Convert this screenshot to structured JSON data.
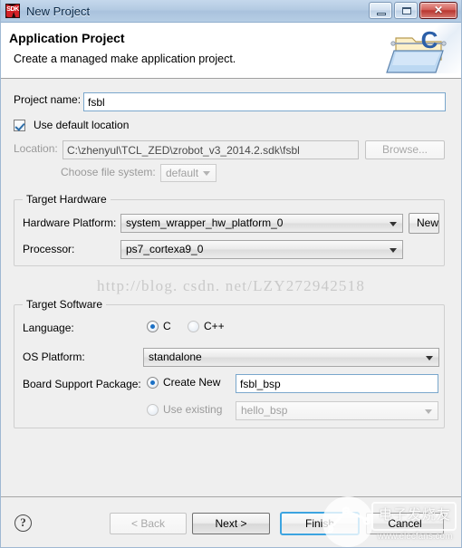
{
  "window": {
    "title": "New Project",
    "app_icon": "sdk-icon",
    "app_icon_text": "SDK",
    "controls": {
      "minimize": "minimize-button",
      "maximize": "maximize-button",
      "close": "close-button",
      "close_glyph": "✕"
    }
  },
  "header": {
    "title": "Application Project",
    "subtitle": "Create a managed make application project.",
    "icon": "c-project-folder-icon"
  },
  "form": {
    "project_name_label": "Project name:",
    "project_name_value": "fsbl",
    "project_name_placeholder": "",
    "use_default_location_label": "Use default location",
    "use_default_location_checked": true,
    "location_label": "Location:",
    "location_value": "C:\\zhenyul\\TCL_ZED\\zrobot_v3_2014.2.sdk\\fsbl",
    "browse_label": "Browse...",
    "choose_fs_label": "Choose file system:",
    "choose_fs_value": "default"
  },
  "target_hardware": {
    "group_title": "Target Hardware",
    "hardware_platform_label": "Hardware Platform:",
    "hardware_platform_value": "system_wrapper_hw_platform_0",
    "new_button_label": "New",
    "processor_label": "Processor:",
    "processor_value": "ps7_cortexa9_0"
  },
  "target_software": {
    "group_title": "Target Software",
    "language_label": "Language:",
    "language_options": [
      {
        "label": "C",
        "selected": true
      },
      {
        "label": "C++",
        "selected": false
      }
    ],
    "os_platform_label": "OS Platform:",
    "os_platform_value": "standalone",
    "bsp_label": "Board Support Package:",
    "bsp_create_new_label": "Create New",
    "bsp_create_new_selected": true,
    "bsp_create_new_value": "fsbl_bsp",
    "bsp_use_existing_label": "Use existing",
    "bsp_use_existing_selected": false,
    "bsp_use_existing_value": "hello_bsp"
  },
  "footer": {
    "help_icon": "help-icon",
    "help_glyph": "?",
    "back_label": "< Back",
    "back_disabled": true,
    "next_label": "Next >",
    "finish_label": "Finish",
    "cancel_label": "Cancel"
  },
  "watermarks": {
    "csdn": "http://blog. csdn. net/LZY272942518",
    "elecfans_cn": "电子发烧友",
    "elecfans_url": "www.elecfans.com"
  },
  "colors": {
    "titlebar": "#aac2dd",
    "body": "#efefef",
    "focus_blue": "#3ca4e0",
    "input_border": "#7aa7cc",
    "accent_radio": "#1a6fc4"
  }
}
